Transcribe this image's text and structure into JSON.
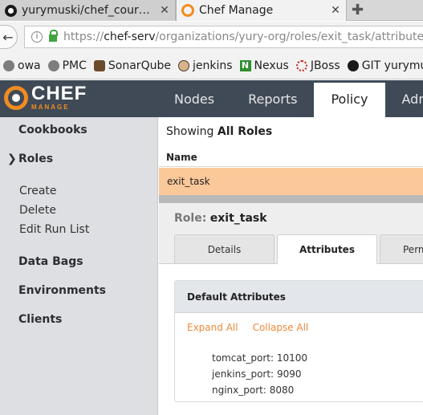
{
  "browser": {
    "tabs": [
      {
        "title": "yurymuski/chef_cour…",
        "close": "✕"
      },
      {
        "title": "Chef Manage",
        "close": "✕"
      }
    ],
    "new_tab": "✚",
    "back": "←",
    "url": {
      "scheme": "https://",
      "host": "chef-serv",
      "path": "/organizations/yury-org/roles/exit_task/attributes"
    },
    "bookmarks": [
      {
        "label": "owa",
        "icon": "globe-icon"
      },
      {
        "label": "PMC",
        "icon": "globe-icon"
      },
      {
        "label": "SonarQube",
        "icon": "sonarqube-icon"
      },
      {
        "label": "jenkins",
        "icon": "jenkins-icon"
      },
      {
        "label": "Nexus",
        "icon": "nexus-icon",
        "glyph": "N"
      },
      {
        "label": "JBoss",
        "icon": "jboss-icon"
      },
      {
        "label": "GIT yurymuski",
        "icon": "github-icon"
      }
    ]
  },
  "app": {
    "logo_word": "CHEF",
    "logo_sub": "MANAGE",
    "nav": [
      "Nodes",
      "Reports",
      "Policy",
      "Admi"
    ],
    "active_nav": "Policy",
    "brand_color": "#f18b21",
    "header_color": "#3f4a56"
  },
  "sidebar": {
    "caret": "❯",
    "items": {
      "cookbooks": "Cookbooks",
      "roles": "Roles",
      "create": "Create",
      "delete": "Delete",
      "edit_run_list": "Edit Run List",
      "data_bags": "Data Bags",
      "environments": "Environments",
      "clients": "Clients"
    }
  },
  "list": {
    "showing_prefix": "Showing",
    "showing_value": "All Roles",
    "column_name": "Name",
    "rows": [
      "exit_task"
    ],
    "selected_row_color": "#fbc89a"
  },
  "role": {
    "label": "Role:",
    "name": "exit_task",
    "tabs": [
      "Details",
      "Attributes",
      "Perm"
    ],
    "active_tab": "Attributes",
    "panel_title": "Default Attributes",
    "expand_all": "Expand All",
    "collapse_all": "Collapse All",
    "attributes": [
      {
        "key": "tomcat_port:",
        "value": "10100"
      },
      {
        "key": "jenkins_port:",
        "value": "9090"
      },
      {
        "key": "nginx_port:",
        "value": "8080"
      }
    ],
    "link_color": "#f0883a"
  }
}
